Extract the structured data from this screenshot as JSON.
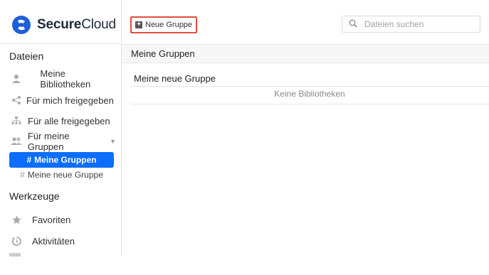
{
  "brand": {
    "name_bold": "Secure",
    "name_rest": "Cloud",
    "logo_icon": "securecloud-logo-icon",
    "accent": "#0d6efd"
  },
  "header": {
    "new_group_label": "Neue Gruppe",
    "new_group_icon": "plus-square-icon",
    "search_placeholder": "Dateien suchen",
    "search_icon": "search-icon"
  },
  "sidebar": {
    "files_heading": "Dateien",
    "items": [
      {
        "label": "Meine Bibliotheken",
        "icon": "user-icon"
      },
      {
        "label": "Für mich freigegeben",
        "icon": "share-icon"
      },
      {
        "label": "Für alle freigegeben",
        "icon": "org-chart-icon"
      },
      {
        "label": "Für meine Gruppen",
        "icon": "group-icon"
      }
    ],
    "groups": [
      {
        "label": "Meine Gruppen",
        "active": true
      },
      {
        "label": "Meine neue Gruppe",
        "active": false
      }
    ],
    "hash": "#",
    "tools_heading": "Werkzeuge",
    "tools": [
      {
        "label": "Favoriten",
        "icon": "star-icon"
      },
      {
        "label": "Aktivitäten",
        "icon": "history-icon"
      }
    ]
  },
  "main": {
    "title": "Meine Gruppen",
    "group_name": "Meine neue Gruppe",
    "empty_message": "Keine Bibliotheken"
  }
}
